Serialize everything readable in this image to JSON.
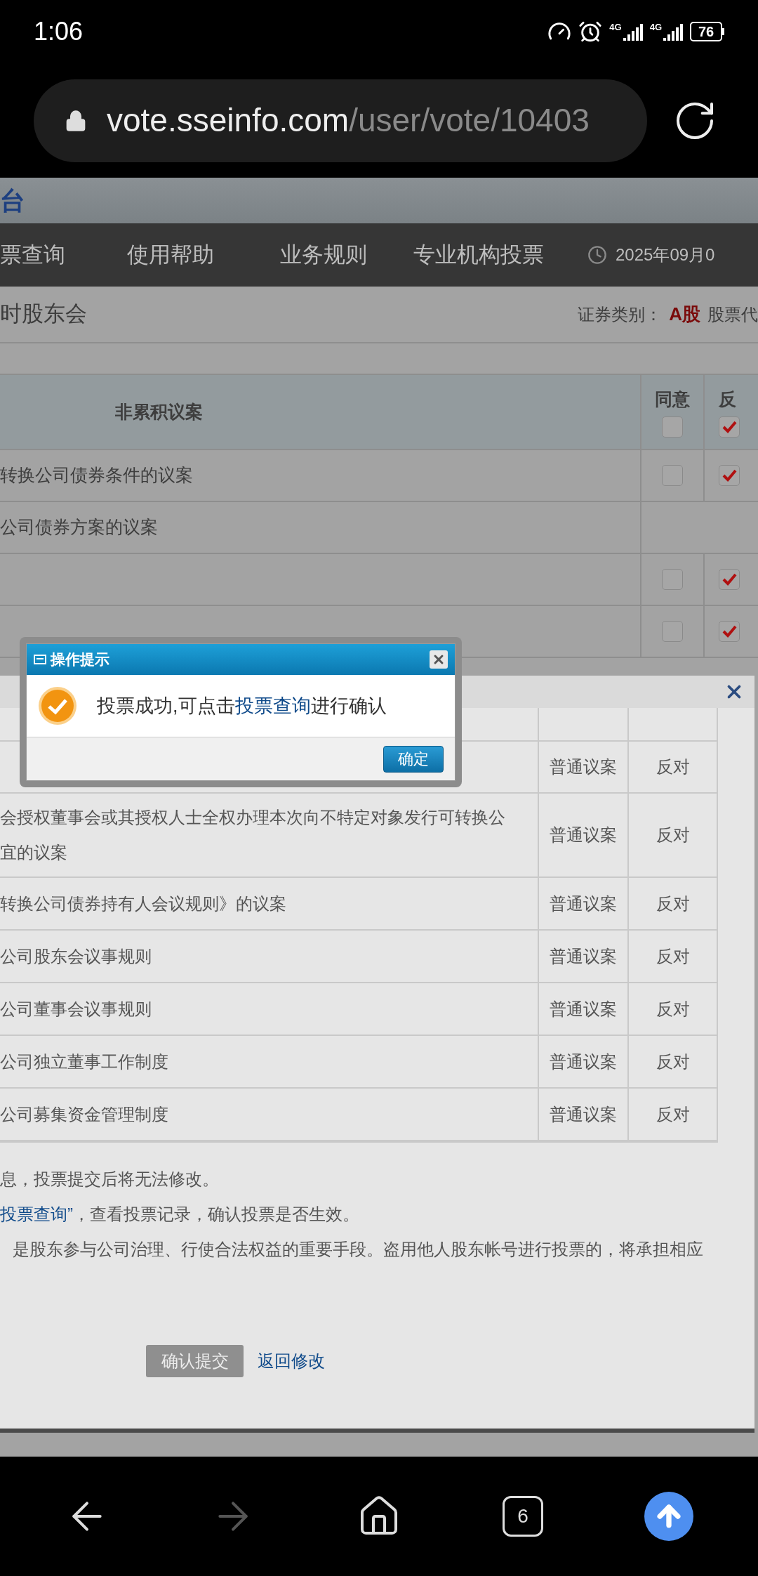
{
  "status_bar": {
    "time": "1:06",
    "signals": [
      {
        "label": "4G"
      },
      {
        "label": "4G"
      }
    ],
    "battery": "76"
  },
  "browser": {
    "url_host": "vote.sseinfo.com",
    "url_path": "/user/vote/10403",
    "tab_count": "6",
    "forward_disabled": true
  },
  "banner": {
    "title": "台"
  },
  "nav": {
    "items": [
      "票查询",
      "使用帮助",
      "业务规则",
      "专业机构投票"
    ],
    "date": "2025年09月0"
  },
  "meeting": {
    "title": "时股东会",
    "category_label": "证券类别：",
    "category": "A股",
    "code_label": "股票代"
  },
  "vote_table": {
    "columns": [
      "非累积议案",
      "同意",
      "反"
    ],
    "header_checks": [
      {
        "checked": false
      },
      {
        "checked": true
      }
    ],
    "rows": [
      {
        "kind": "item",
        "name": "转换公司债券条件的议案",
        "agree": false,
        "against": true
      },
      {
        "kind": "group",
        "name": "公司债券方案的议案"
      },
      {
        "kind": "item",
        "agree": false,
        "against": true
      },
      {
        "kind": "item",
        "agree": false,
        "against": true
      }
    ]
  },
  "confirm_panel": {
    "rows": [
      {
        "type": "普通议案",
        "vote": "反对"
      },
      {
        "lines": [
          "会授权董事会或其授权人士全权办理本次向不特定对象发行可转换公",
          "宜的议案"
        ],
        "type": "普通议案",
        "vote": "反对"
      },
      {
        "lines": [
          "转换公司债券持有人会议规则》的议案"
        ],
        "type": "普通议案",
        "vote": "反对"
      },
      {
        "lines": [
          "公司股东会议事规则"
        ],
        "type": "普通议案",
        "vote": "反对"
      },
      {
        "lines": [
          "公司董事会议事规则"
        ],
        "type": "普通议案",
        "vote": "反对"
      },
      {
        "lines": [
          "公司独立董事工作制度"
        ],
        "type": "普通议案",
        "vote": "反对"
      },
      {
        "lines": [
          "公司募集资金管理制度"
        ],
        "type": "普通议案",
        "vote": "反对"
      }
    ],
    "notes": [
      {
        "text": "息，投票提交后将无法修改。",
        "indent": false
      },
      {
        "link": "投票查询”",
        "text": "，查看投票记录，确认投票是否生效。",
        "indent": false
      },
      {
        "text": "是股东参与公司治理、行使合法权益的重要手段。盗用他人股东帐号进行投票的，将承担相应",
        "indent": true
      }
    ],
    "submit": "确认提交",
    "back": "返回修改"
  },
  "dialog": {
    "title": "操作提示",
    "message_before": "投票成功,可点击",
    "message_link": "投票查询",
    "message_after": "进行确认",
    "ok": "确定"
  }
}
